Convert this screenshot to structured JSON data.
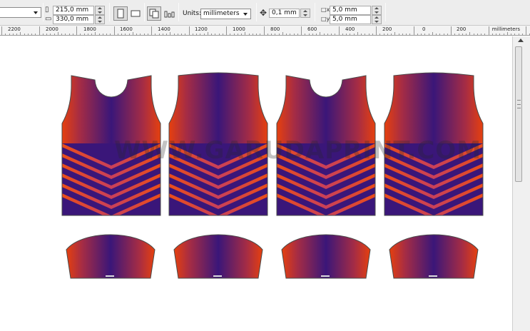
{
  "toolbar": {
    "width_value": "215,0 mm",
    "height_value": "330,0 mm",
    "units_label": "Units:",
    "units_value": "millimeters",
    "nudge_value": "0,1 mm",
    "dup_x_value": "5,0 mm",
    "dup_y_value": "5,0 mm"
  },
  "ruler": {
    "ticks": [
      "2200",
      "2000",
      "1800",
      "1600",
      "1400",
      "1200",
      "1000",
      "800",
      "600",
      "400",
      "200",
      "0",
      "200"
    ],
    "units_label": "millimeters"
  },
  "canvas": {
    "watermark": "WWW.GARUDAPRINT.COM"
  },
  "colors": {
    "jersey_center": "#3a1679",
    "jersey_edge": "#e6400e",
    "outline": "#4a4a4a"
  },
  "icons": [
    "page-portrait-icon",
    "page-landscape-icon",
    "all-pages-icon",
    "current-page-icon",
    "nudge-icon",
    "duplicate-x-icon",
    "duplicate-y-icon"
  ]
}
